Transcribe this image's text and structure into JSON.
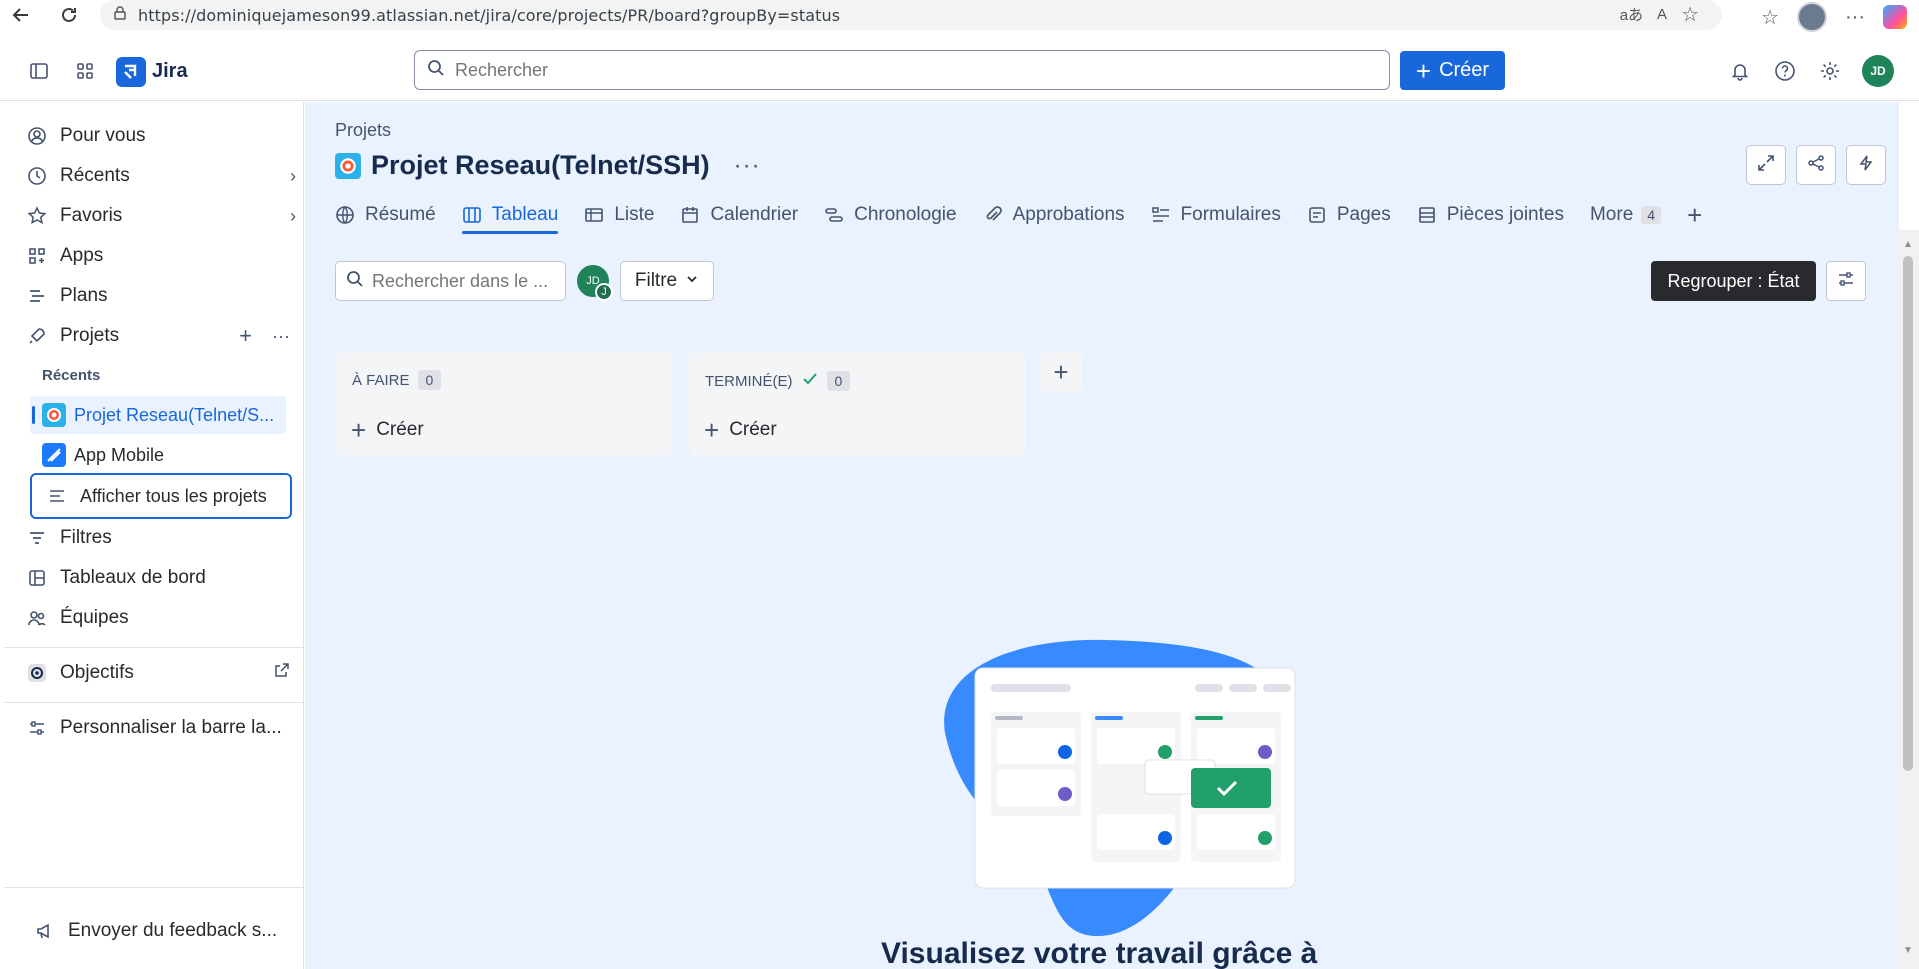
{
  "browser": {
    "url": "https://dominiquejameson99.atlassian.net/jira/core/projects/PR/board?groupBy=status"
  },
  "topnav": {
    "app_name": "Jira",
    "search_placeholder": "Rechercher",
    "create_label": "Créer",
    "avatar_initials": "JD"
  },
  "sidebar": {
    "items": {
      "for_you": "Pour vous",
      "recent": "Récents",
      "favorites": "Favoris",
      "apps": "Apps",
      "plans": "Plans",
      "projects": "Projets",
      "filters": "Filtres",
      "dashboards": "Tableaux de bord",
      "teams": "Équipes",
      "goals": "Objectifs",
      "customize": "Personnaliser la barre la...",
      "feedback": "Envoyer du feedback s..."
    },
    "recent_label": "Récents",
    "recent_projects": [
      {
        "name": "Projet Reseau(Telnet/S..."
      },
      {
        "name": "App Mobile"
      }
    ],
    "show_all": "Afficher tous les projets"
  },
  "main": {
    "breadcrumb": "Projets",
    "project_title": "Projet Reseau(Telnet/SSH)",
    "tabs": [
      {
        "label": "Résumé",
        "icon": "globe-icon"
      },
      {
        "label": "Tableau",
        "icon": "board-icon"
      },
      {
        "label": "Liste",
        "icon": "list-icon"
      },
      {
        "label": "Calendrier",
        "icon": "calendar-icon"
      },
      {
        "label": "Chronologie",
        "icon": "timeline-icon"
      },
      {
        "label": "Approbations",
        "icon": "paperclip-icon"
      },
      {
        "label": "Formulaires",
        "icon": "form-icon"
      },
      {
        "label": "Pages",
        "icon": "page-icon"
      },
      {
        "label": "Pièces jointes",
        "icon": "attachment-icon"
      },
      {
        "label": "More",
        "icon": ""
      }
    ],
    "more_count": "4",
    "board_search_placeholder": "Rechercher dans le ...",
    "filter_avatar": "JD",
    "filter_avatar_sub": "J",
    "filter_label": "Filtre",
    "group_label": "Regrouper : État",
    "columns": [
      {
        "title": "À FAIRE",
        "count": "0",
        "create": "Créer"
      },
      {
        "title": "TERMINÉ(E)",
        "count": "0",
        "create": "Créer"
      }
    ],
    "empty_title": "Visualisez votre travail grâce à"
  },
  "colors": {
    "accent": "#1868db",
    "content_bg": "#e9f2fe",
    "avatar_green": "#1f845a"
  }
}
